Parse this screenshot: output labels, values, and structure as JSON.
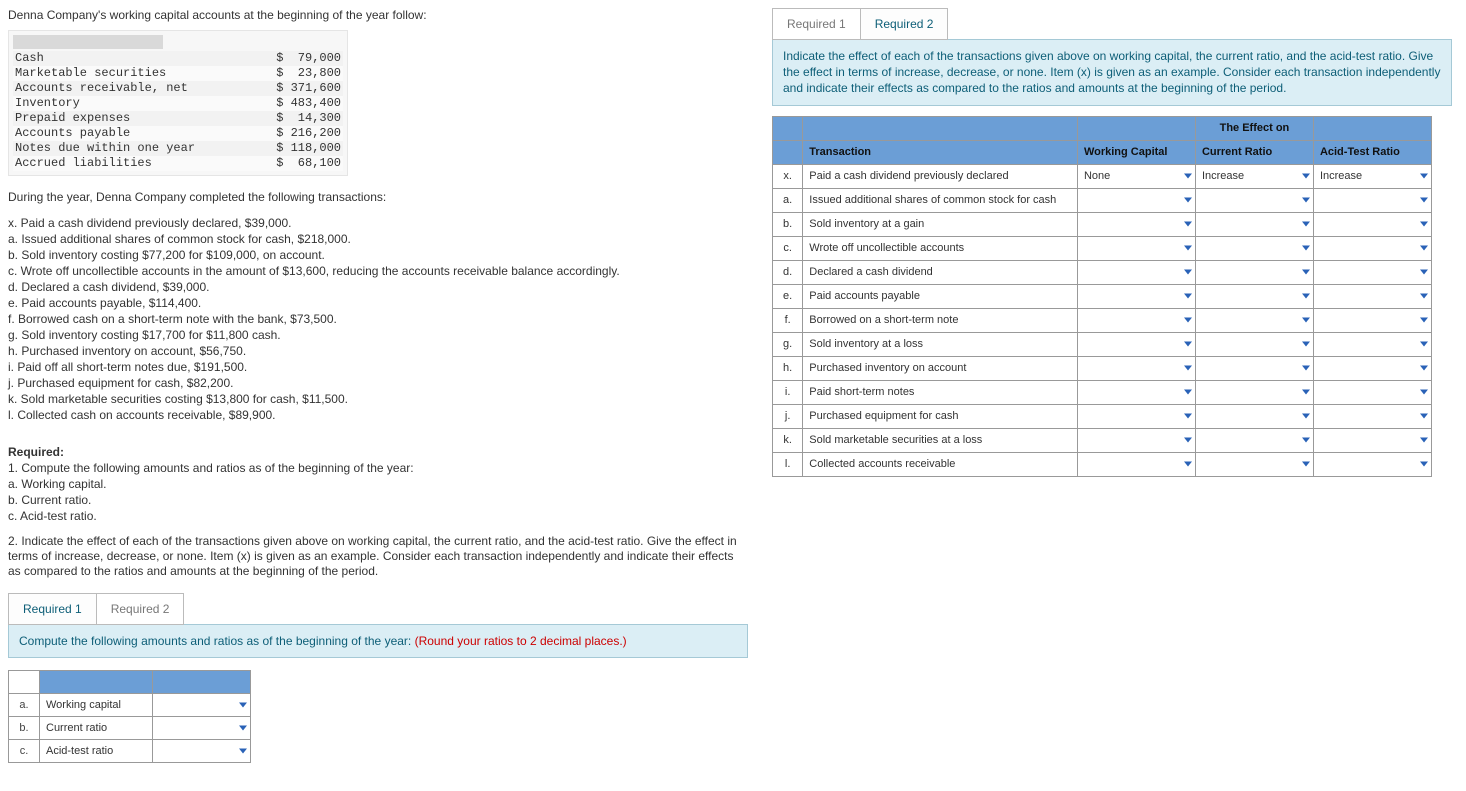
{
  "intro": "Denna Company's working capital accounts at the beginning of the year follow:",
  "accounts": [
    {
      "name": "Cash",
      "amount": "$  79,000"
    },
    {
      "name": "Marketable securities",
      "amount": "$  23,800"
    },
    {
      "name": "Accounts receivable, net",
      "amount": "$ 371,600"
    },
    {
      "name": "Inventory",
      "amount": "$ 483,400"
    },
    {
      "name": "Prepaid expenses",
      "amount": "$  14,300"
    },
    {
      "name": "Accounts payable",
      "amount": "$ 216,200"
    },
    {
      "name": "Notes due within one year",
      "amount": "$ 118,000"
    },
    {
      "name": "Accrued liabilities",
      "amount": "$  68,100"
    }
  ],
  "during_intro": "During the year, Denna Company completed the following transactions:",
  "transactions_text": [
    "x. Paid a cash dividend previously declared, $39,000.",
    "a. Issued additional shares of common stock for cash, $218,000.",
    "b. Sold inventory costing $77,200 for $109,000, on account.",
    "c. Wrote off uncollectible accounts in the amount of $13,600, reducing the accounts receivable balance accordingly.",
    "d. Declared a cash dividend, $39,000.",
    "e. Paid accounts payable, $114,400.",
    "f. Borrowed cash on a short-term note with the bank, $73,500.",
    "g. Sold inventory costing $17,700 for $11,800 cash.",
    "h. Purchased inventory on account, $56,750.",
    "i. Paid off all short-term notes due, $191,500.",
    "j. Purchased equipment for cash, $82,200.",
    "k. Sold marketable securities costing $13,800 for cash, $11,500.",
    "l. Collected cash on accounts receivable, $89,900."
  ],
  "required": {
    "heading": "Required:",
    "line1": "1. Compute the following amounts and ratios as of the beginning of the year:",
    "line1a": "a. Working capital.",
    "line1b": "b. Current ratio.",
    "line1c": "c. Acid-test ratio.",
    "line2": "2. Indicate the effect of each of the transactions given above on working capital, the current ratio, and the acid-test ratio. Give the effect in terms of increase, decrease, or none. Item (x) is given as an example. Consider each transaction independently and indicate their effects as compared to the ratios and amounts at the beginning of the period."
  },
  "tabs": {
    "r1": "Required 1",
    "r2": "Required 2"
  },
  "left_instruction_main": "Compute the following amounts and ratios as of the beginning of the year: ",
  "left_instruction_note": "(Round your ratios to 2 decimal places.)",
  "left_rows": [
    {
      "lbl": "a.",
      "desc": "Working capital"
    },
    {
      "lbl": "b.",
      "desc": "Current ratio"
    },
    {
      "lbl": "c.",
      "desc": "Acid-test ratio"
    }
  ],
  "right_instruction": "Indicate the effect of each of the transactions given above on working capital, the current ratio, and the acid-test ratio. Give the effect in terms of increase, decrease, or none. Item (x) is given as an example. Consider each transaction independently and indicate their effects as compared to the ratios and amounts at the beginning of the period.",
  "effects_header": {
    "transaction": "Transaction",
    "span": "The Effect on",
    "wc": "Working Capital",
    "cr": "Current Ratio",
    "at": "Acid-Test Ratio"
  },
  "effects_rows": [
    {
      "lbl": "x.",
      "desc": "Paid a cash dividend previously declared",
      "wc": "None",
      "cr": "Increase",
      "at": "Increase"
    },
    {
      "lbl": "a.",
      "desc": "Issued additional shares of common stock for cash",
      "wc": "",
      "cr": "",
      "at": ""
    },
    {
      "lbl": "b.",
      "desc": "Sold inventory at a gain",
      "wc": "",
      "cr": "",
      "at": ""
    },
    {
      "lbl": "c.",
      "desc": "Wrote off uncollectible accounts",
      "wc": "",
      "cr": "",
      "at": ""
    },
    {
      "lbl": "d.",
      "desc": "Declared a cash dividend",
      "wc": "",
      "cr": "",
      "at": ""
    },
    {
      "lbl": "e.",
      "desc": "Paid accounts payable",
      "wc": "",
      "cr": "",
      "at": ""
    },
    {
      "lbl": "f.",
      "desc": "Borrowed on a short-term note",
      "wc": "",
      "cr": "",
      "at": ""
    },
    {
      "lbl": "g.",
      "desc": "Sold inventory at a loss",
      "wc": "",
      "cr": "",
      "at": ""
    },
    {
      "lbl": "h.",
      "desc": "Purchased inventory on account",
      "wc": "",
      "cr": "",
      "at": ""
    },
    {
      "lbl": "i.",
      "desc": "Paid short-term notes",
      "wc": "",
      "cr": "",
      "at": ""
    },
    {
      "lbl": "j.",
      "desc": "Purchased equipment for cash",
      "wc": "",
      "cr": "",
      "at": ""
    },
    {
      "lbl": "k.",
      "desc": "Sold marketable securities at a loss",
      "wc": "",
      "cr": "",
      "at": ""
    },
    {
      "lbl": "l.",
      "desc": "Collected accounts receivable",
      "wc": "",
      "cr": "",
      "at": ""
    }
  ]
}
